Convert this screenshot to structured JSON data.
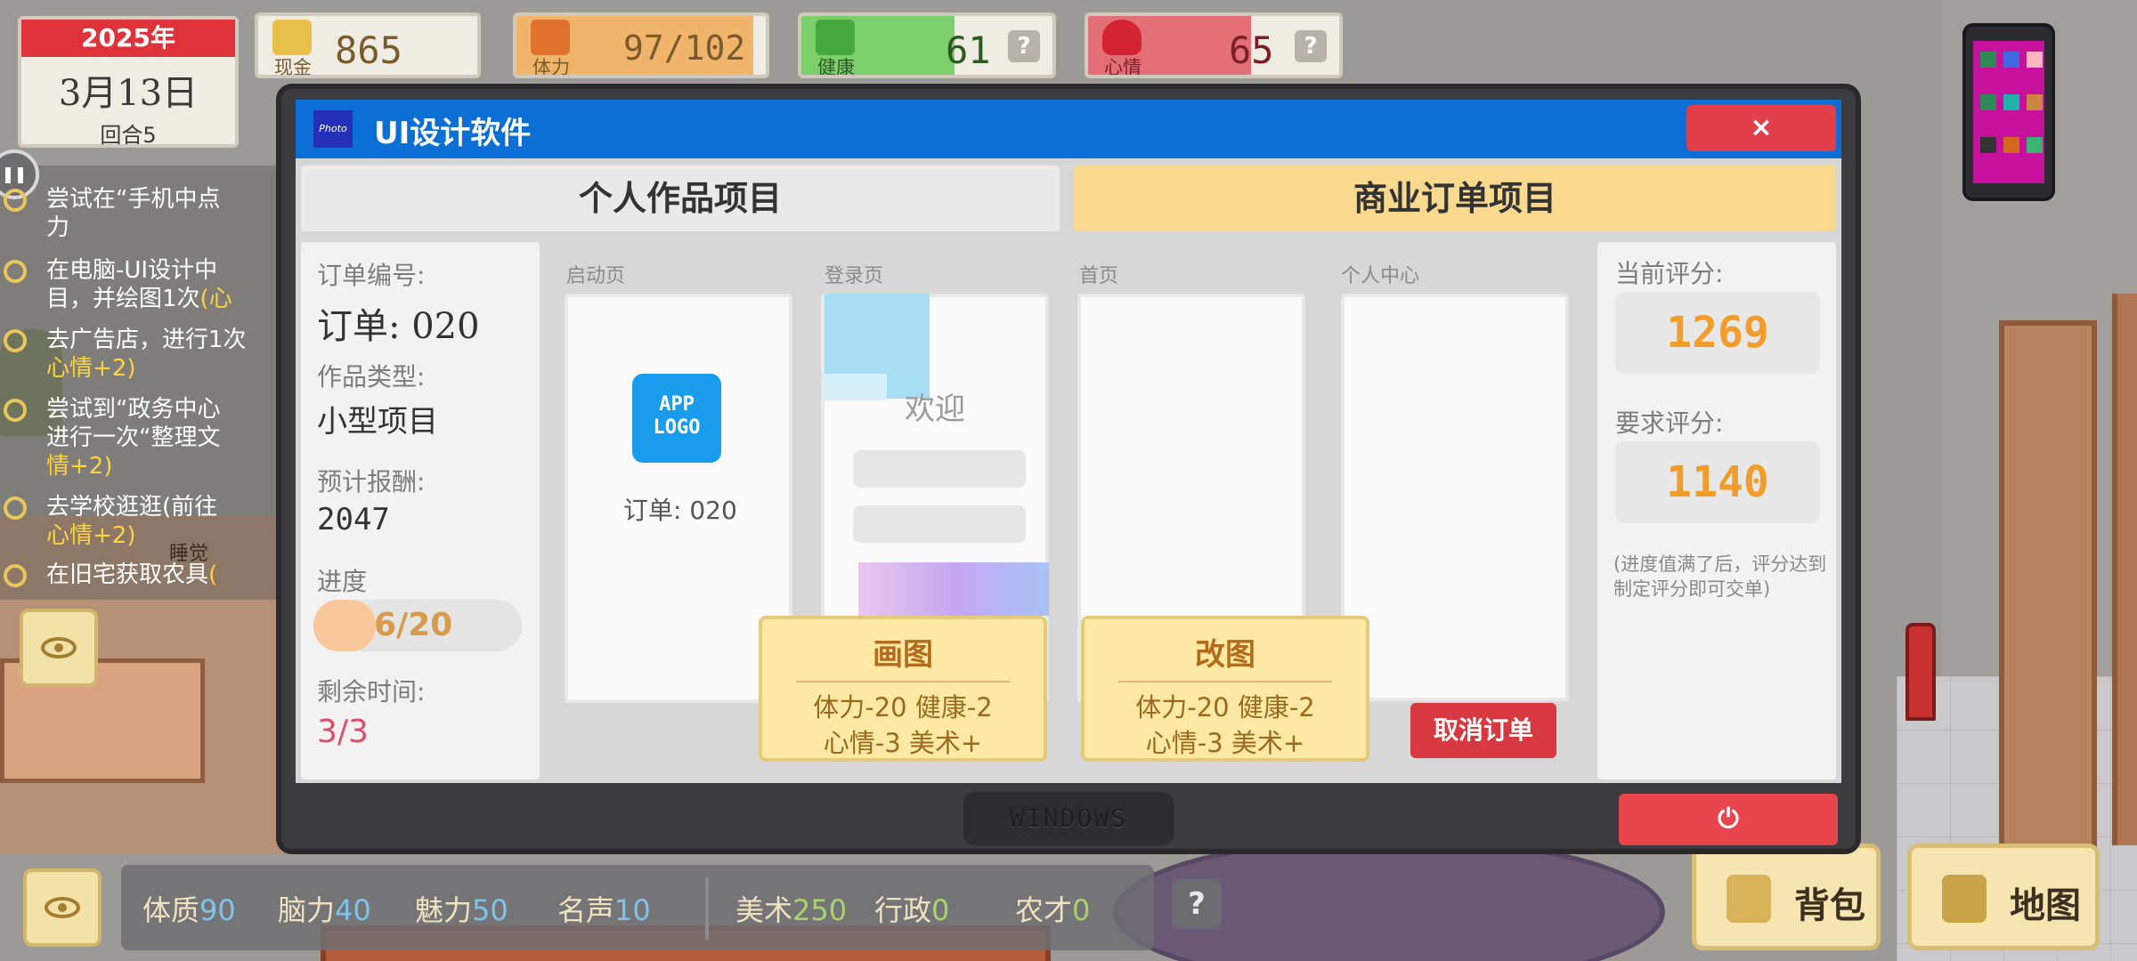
{
  "date": {
    "year": "2025年",
    "day": "3月13日",
    "round": "回合5"
  },
  "stats": {
    "cash": {
      "label": "现金",
      "value": "865",
      "color": "#e8c04a"
    },
    "stamina": {
      "label": "体力",
      "value": "97/102",
      "fill": 0.95,
      "color": "#f0b46a"
    },
    "health": {
      "label": "健康",
      "value": "61",
      "fill": 0.61,
      "color": "#7dcf6b",
      "help": "?"
    },
    "mood": {
      "label": "心情",
      "value": "65",
      "fill": 0.65,
      "color": "#e46f76",
      "help": "?"
    }
  },
  "quests": [
    {
      "text": "尝试在“手机中点",
      "text2": "力",
      "highlight": ""
    },
    {
      "text": "在电脑-UI设计中",
      "text2": "目，并绘图1次",
      "highlight": "(心"
    },
    {
      "text": "去广告店，进行1次",
      "text2": "",
      "highlight": "心情+2)"
    },
    {
      "text": "尝试到“政务中心",
      "text2": "进行一次“整理文",
      "highlight": "情+2)"
    },
    {
      "text": "去学校逛逛(前往",
      "text2": "",
      "highlight": "心情+2)"
    },
    {
      "text": "在旧宅获取农具",
      "text2": "",
      "highlight": "("
    }
  ],
  "sleep_label": "睡觉",
  "bottom_attrs": [
    {
      "label": "体质",
      "value": "90"
    },
    {
      "label": "脑力",
      "value": "40"
    },
    {
      "label": "魅力",
      "value": "50"
    },
    {
      "label": "名声",
      "value": "10"
    },
    {
      "label": "美术",
      "value": "250"
    },
    {
      "label": "行政",
      "value": "0"
    },
    {
      "label": "农才",
      "value": "0"
    }
  ],
  "bottom_help": "?",
  "buttons": {
    "bag": "背包",
    "map": "地图"
  },
  "window": {
    "app_icon": "Photo",
    "title": "UI设计软件",
    "close": "×",
    "tabs": {
      "personal": "个人作品项目",
      "business": "商业订单项目"
    },
    "order": {
      "number_label": "订单编号:",
      "number_value": "订单: 020",
      "type_label": "作品类型:",
      "type_value": "小型项目",
      "reward_label": "预计报酬:",
      "reward_value": "2047",
      "progress_label": "进度",
      "progress_value": "6/20",
      "progress_fraction": 0.3,
      "time_label": "剩余时间:",
      "time_value": "3/3"
    },
    "pages": {
      "splash": "启动页",
      "login": "登录页",
      "home": "首页",
      "profile": "个人中心"
    },
    "logo_line1": "APP",
    "logo_line2": "LOGO",
    "order_small": "订单: 020",
    "welcome": "欢迎",
    "draw_button": {
      "title": "画图",
      "cost1": "体力-20 健康-2",
      "cost2": "心情-3 美术+"
    },
    "revise_button": {
      "title": "改图",
      "cost1": "体力-20 健康-2",
      "cost2": "心情-3 美术+"
    },
    "cancel_order": "取消订单",
    "score": {
      "current_label": "当前评分:",
      "current_value": "1269",
      "required_label": "要求评分:",
      "required_value": "1140",
      "note": "(进度值满了后，评分达到制定评分即可交单)"
    },
    "taskbar": "WINDOWS",
    "power": "⏻"
  }
}
